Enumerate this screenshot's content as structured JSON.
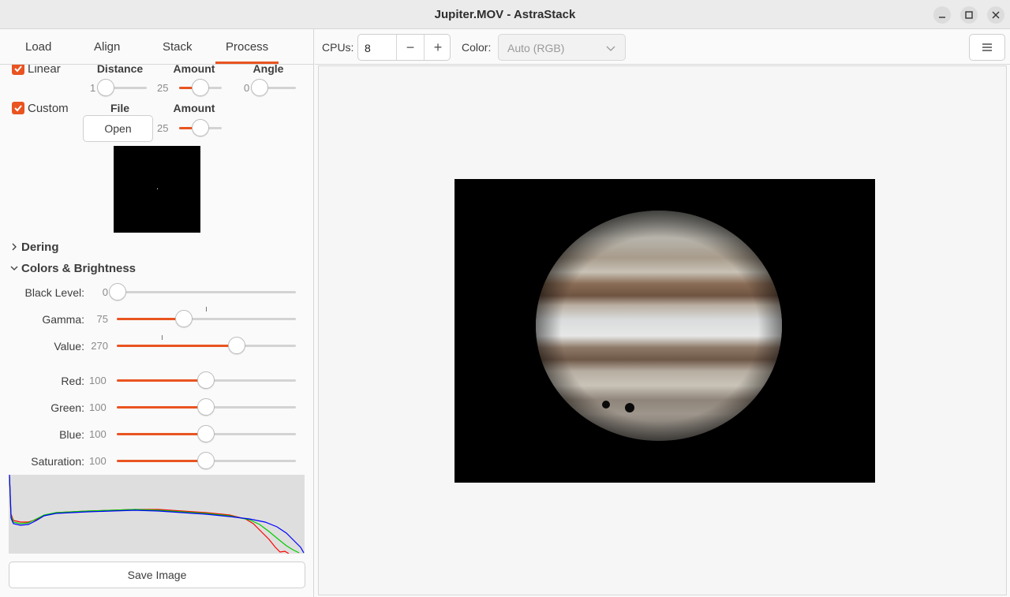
{
  "window": {
    "title": "Jupiter.MOV - AstraStack",
    "controls": [
      "minimize-icon",
      "maximize-icon",
      "close-icon"
    ]
  },
  "tabs": [
    {
      "label": "Load"
    },
    {
      "label": "Align"
    },
    {
      "label": "Stack"
    },
    {
      "label": "Process",
      "selected": true
    }
  ],
  "toolbar": {
    "cpus_label": "CPUs:",
    "cpus_value": "8",
    "minus": "−",
    "plus": "+",
    "color_label": "Color:",
    "color_value": "Auto (RGB)",
    "menu_icon": "hamburger-menu-icon"
  },
  "linear": {
    "label": "Linear",
    "checked": true,
    "distance_header": "Distance",
    "amount_header": "Amount",
    "angle_header": "Angle",
    "distance_value": "1",
    "amount_value": "25",
    "angle_value": "0"
  },
  "custom": {
    "label": "Custom",
    "checked": true,
    "file_header": "File",
    "amount_header": "Amount",
    "open_label": "Open",
    "amount_value": "25"
  },
  "sections": {
    "dering": {
      "label": "Dering",
      "expanded": false
    },
    "colors": {
      "label": "Colors & Brightness",
      "expanded": true
    }
  },
  "sliders": {
    "black_level": {
      "label": "Black Level:",
      "value": "0",
      "fraction": 0.0
    },
    "gamma": {
      "label": "Gamma:",
      "value": "75",
      "fraction": 0.375
    },
    "value": {
      "label": "Value:",
      "value": "270",
      "fraction": 0.675
    },
    "red": {
      "label": "Red:",
      "value": "100",
      "fraction": 0.5
    },
    "green": {
      "label": "Green:",
      "value": "100",
      "fraction": 0.5
    },
    "blue": {
      "label": "Blue:",
      "value": "100",
      "fraction": 0.5
    },
    "saturation": {
      "label": "Saturation:",
      "value": "100",
      "fraction": 0.5
    }
  },
  "save_label": "Save Image",
  "colors": {
    "accent": "#e95420",
    "histogram_bg": "#dedede",
    "histogram_red": "#ff0000",
    "histogram_green": "#00cc00",
    "histogram_blue": "#0000ff"
  }
}
